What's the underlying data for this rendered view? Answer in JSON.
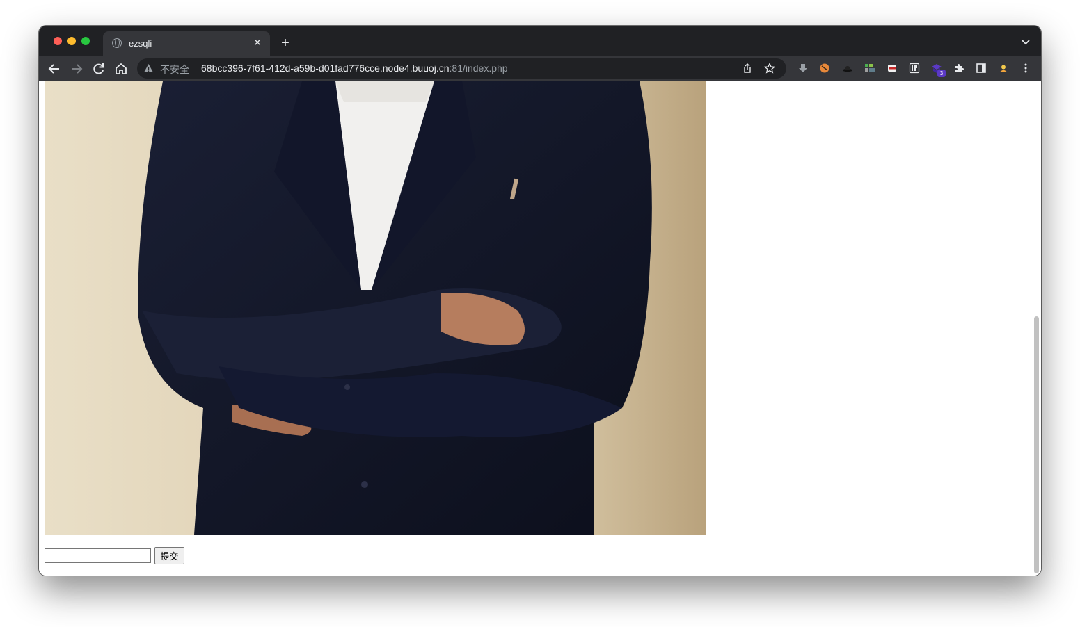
{
  "tab": {
    "title": "ezsqli",
    "close_symbol": "✕",
    "new_tab_symbol": "+"
  },
  "omnibox": {
    "security_label": "不安全",
    "url_host": "68bcc396-7f61-412d-a59b-d01fad776cce.node4.buuoj.cn",
    "url_rest": ":81/index.php"
  },
  "extensions": {
    "badge_count": "3"
  },
  "page": {
    "image_description_icon": "photo-of-person-in-suit",
    "input_value": "",
    "submit_label": "提交"
  },
  "colors": {
    "chrome_dark": "#202124",
    "toolbar": "#35363a",
    "page_bg": "#ffffff"
  }
}
